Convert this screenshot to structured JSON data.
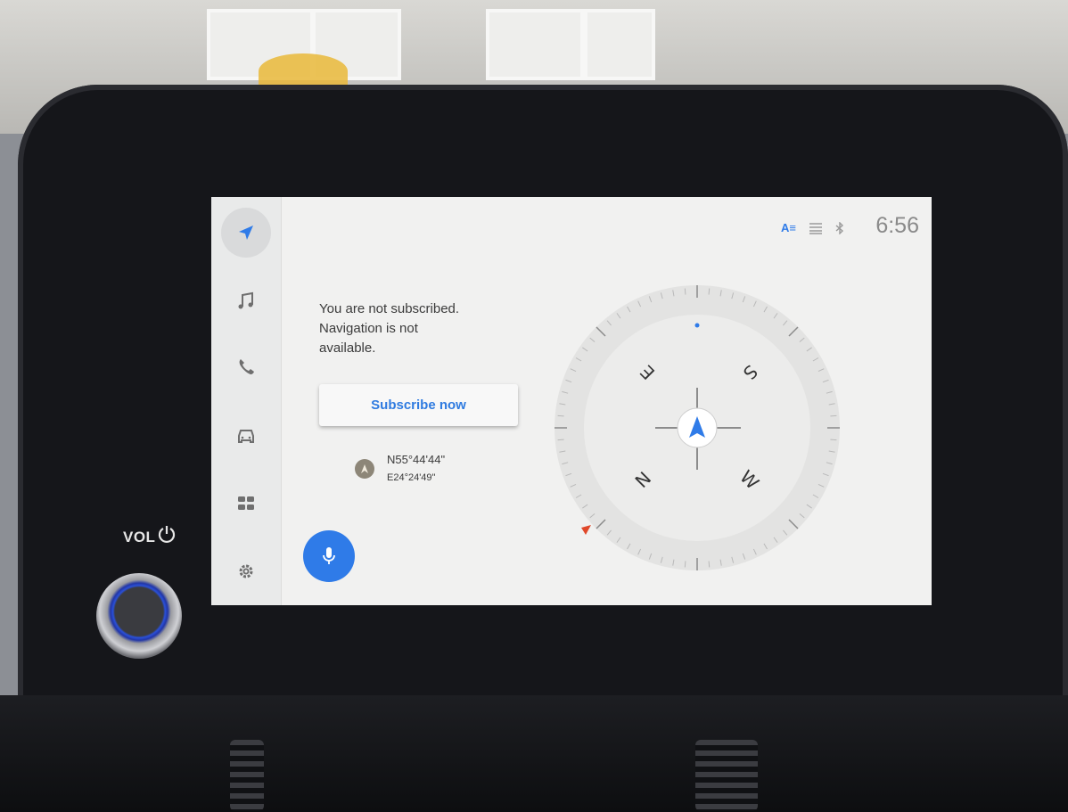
{
  "screen": {
    "clock": "6:56",
    "status_icons": [
      "text-icon",
      "grid-icon",
      "bluetooth-icon"
    ],
    "accent_color": "#2f7be8"
  },
  "rail": {
    "items": [
      {
        "icon": "navigation-arrow-icon",
        "active": true
      },
      {
        "icon": "music-note-icon"
      },
      {
        "icon": "phone-icon"
      },
      {
        "icon": "car-icon"
      },
      {
        "icon": "apps-grid-icon"
      },
      {
        "icon": "settings-gear-icon"
      }
    ]
  },
  "main": {
    "message": {
      "line1": "You are not subscribed.",
      "line2": "Navigation is not",
      "line3": "available."
    },
    "subscribe_label": "Subscribe now",
    "coordinates": {
      "lat": "N55°44'44\"",
      "lon": "E24°24'49\""
    }
  },
  "compass": {
    "letters": {
      "e": "E",
      "s": "S",
      "n": "N",
      "w": "W"
    }
  },
  "console": {
    "vol_label": "VOL"
  }
}
